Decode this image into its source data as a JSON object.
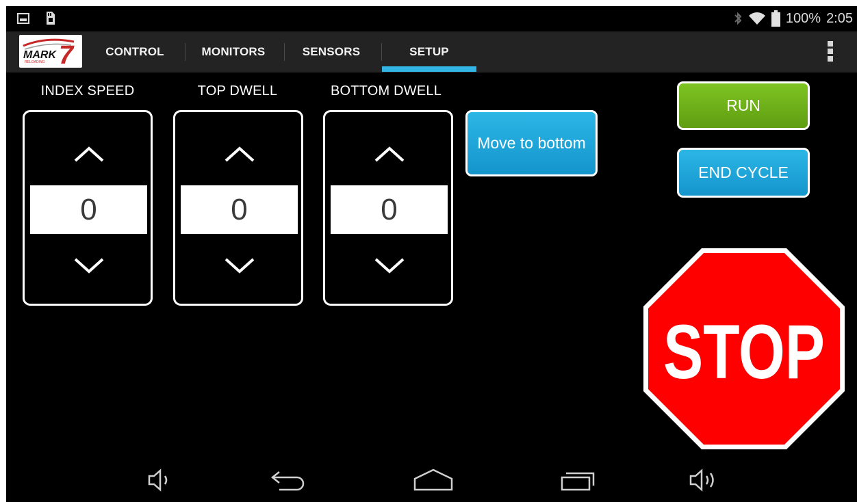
{
  "status_bar": {
    "battery_text": "100%",
    "time": "2:05",
    "icons": [
      "gallery-icon",
      "sd-card-icon",
      "bluetooth-icon",
      "wifi-icon",
      "battery-icon"
    ]
  },
  "app": {
    "logo_text": "MARK",
    "logo_number": "7",
    "logo_subtext": "RELOADING"
  },
  "tabs": [
    {
      "label": "CONTROL",
      "selected": false
    },
    {
      "label": "MONITORS",
      "selected": false
    },
    {
      "label": "SENSORS",
      "selected": false
    },
    {
      "label": "SETUP",
      "selected": true
    }
  ],
  "accent_color": "#33b5e5",
  "controls": [
    {
      "label": "INDEX SPEED",
      "value": "0"
    },
    {
      "label": "TOP DWELL",
      "value": "0"
    },
    {
      "label": "BOTTOM DWELL",
      "value": "0"
    }
  ],
  "buttons": {
    "move_to_bottom": "Move to bottom",
    "run": "RUN",
    "end_cycle": "END CYCLE",
    "stop": "STOP"
  },
  "colors": {
    "run": "#6faf1a",
    "blue_button": "#1ea6dc",
    "stop_red": "#ff0000"
  },
  "nav_icons": [
    "volume-down-icon",
    "back-icon",
    "home-icon",
    "recent-apps-icon",
    "volume-up-icon"
  ]
}
